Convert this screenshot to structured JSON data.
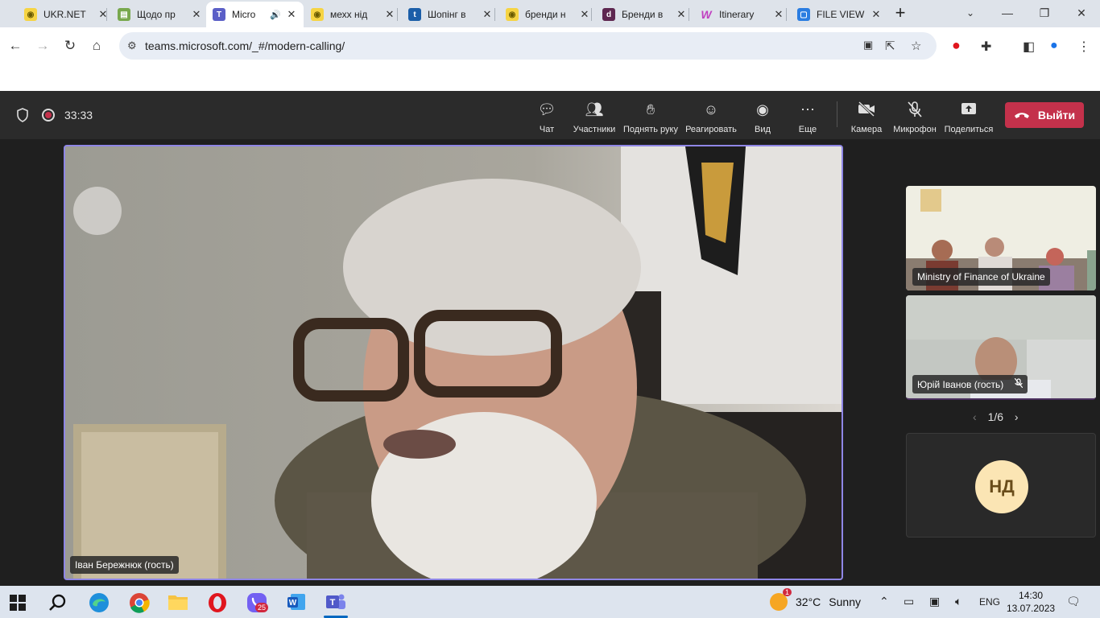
{
  "browser": {
    "tabs": [
      {
        "title": "UKR.NET",
        "favicon": "ukrnet-icon",
        "active": false
      },
      {
        "title": "Щодо пр",
        "favicon": "gov-icon",
        "active": false
      },
      {
        "title": "Micro",
        "favicon": "teams-icon",
        "active": true,
        "audio": true
      },
      {
        "title": "мехх нід",
        "favicon": "ukrnet-icon",
        "active": false
      },
      {
        "title": "Шопінг в",
        "favicon": "t-icon",
        "active": false
      },
      {
        "title": "бренди н",
        "favicon": "ukrnet-icon",
        "active": false
      },
      {
        "title": "Бренди в",
        "favicon": "db-icon",
        "active": false
      },
      {
        "title": "Itinerary",
        "favicon": "w-icon",
        "active": false
      },
      {
        "title": "FILE VIEW",
        "favicon": "doc-icon",
        "active": false
      }
    ],
    "url": "teams.microsoft.com/_#/modern-calling/"
  },
  "meeting": {
    "timer": "33:33",
    "controls": [
      {
        "label": "Чат",
        "icon": "chat-icon"
      },
      {
        "label": "Участники",
        "icon": "people-icon"
      },
      {
        "label": "Поднять руку",
        "icon": "hand-icon"
      },
      {
        "label": "Реагировать",
        "icon": "smile-icon"
      },
      {
        "label": "Вид",
        "icon": "view-icon"
      },
      {
        "label": "Еще",
        "icon": "more-icon"
      },
      {
        "label": "Камера",
        "icon": "camera-off-icon"
      },
      {
        "label": "Микрофон",
        "icon": "mic-off-icon"
      },
      {
        "label": "Поделиться",
        "icon": "share-icon"
      }
    ],
    "leave_label": "Выйти",
    "main_speaker": "Іван Бережнюк (гость)",
    "thumbnails": [
      {
        "name": "Ministry of Finance of Ukraine"
      },
      {
        "name": "Юрій Іванов (гость)",
        "muted": true
      }
    ],
    "pager": "1/6",
    "avatar_initials": "НД",
    "colors": {
      "leave": "#c4314b",
      "speaker_border": "#8f86e6",
      "avatar_bg": "#fbe5b4"
    }
  },
  "taskbar": {
    "weather_temp": "32°C",
    "weather_text": "Sunny",
    "weather_badge": "1",
    "viber_badge": "25",
    "language": "ENG",
    "time": "14:30",
    "date": "13.07.2023"
  }
}
